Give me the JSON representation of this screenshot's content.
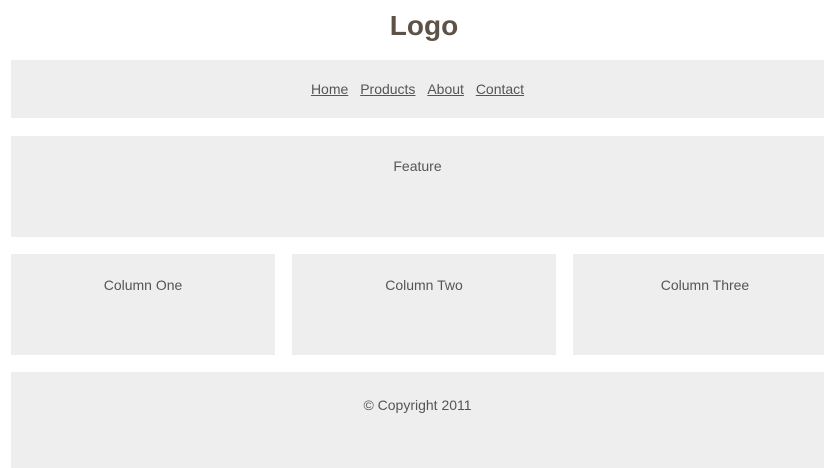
{
  "header": {
    "logo": "Logo"
  },
  "nav": {
    "items": [
      {
        "label": "Home"
      },
      {
        "label": "Products"
      },
      {
        "label": "About"
      },
      {
        "label": "Contact"
      }
    ]
  },
  "feature": {
    "label": "Feature"
  },
  "columns": [
    {
      "label": "Column One"
    },
    {
      "label": "Column Two"
    },
    {
      "label": "Column Three"
    }
  ],
  "footer": {
    "copyright": "© Copyright 2011"
  },
  "colors": {
    "background": "#ffffff",
    "panel": "#eeeeee",
    "logo_text": "#5e5247",
    "body_text": "#555555"
  }
}
